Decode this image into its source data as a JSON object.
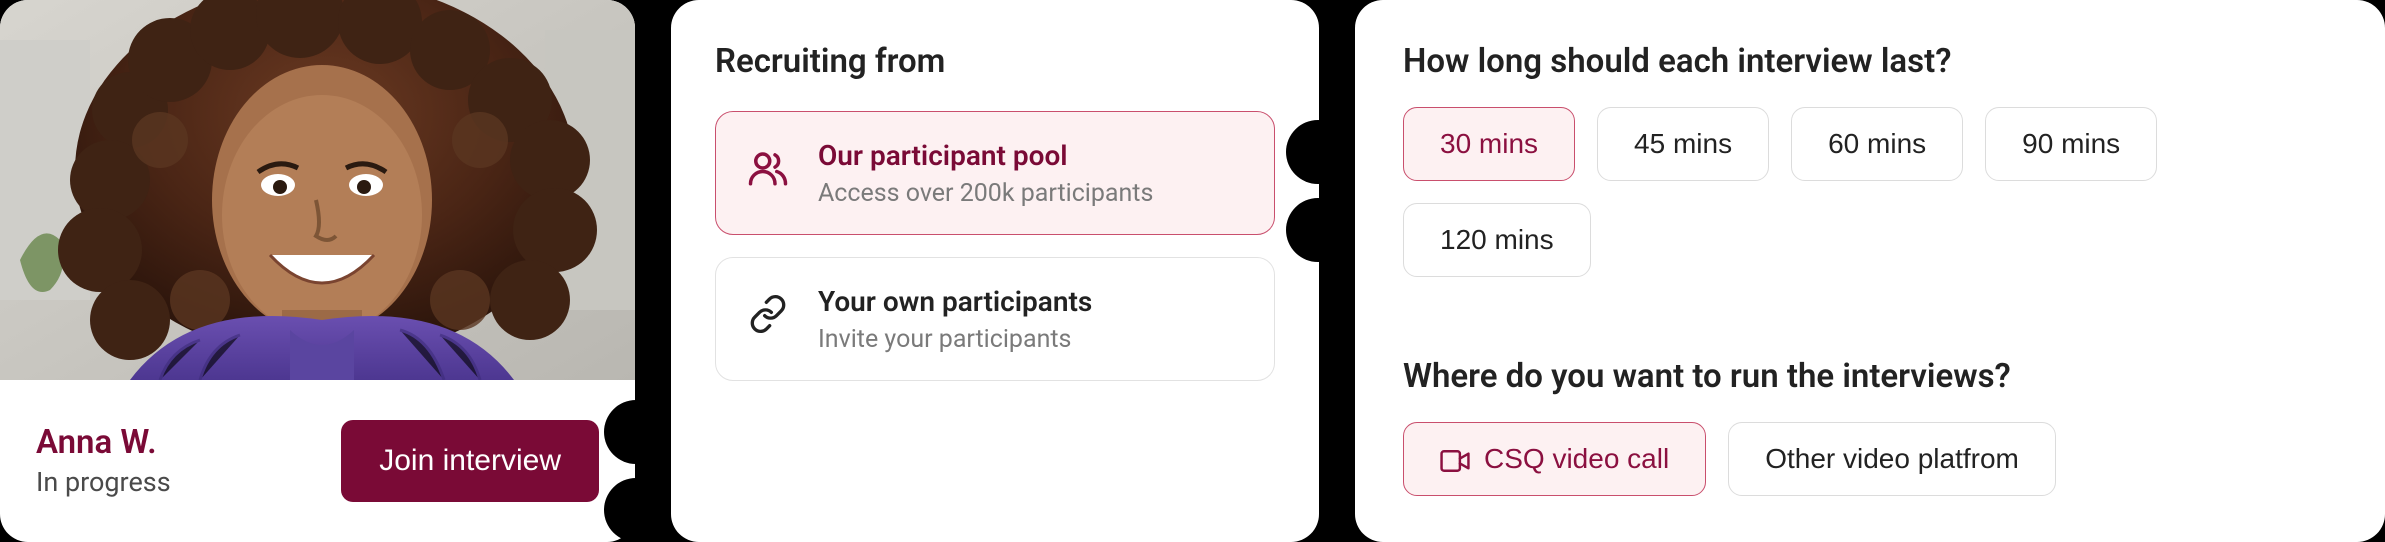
{
  "participant": {
    "name": "Anna W.",
    "status": "In progress",
    "join_label": "Join interview"
  },
  "recruiting": {
    "title": "Recruiting from",
    "options": [
      {
        "title": "Our participant pool",
        "sub": "Access over 200k participants",
        "selected": true,
        "icon": "people-icon"
      },
      {
        "title": "Your own participants",
        "sub": "Invite your participants",
        "selected": false,
        "icon": "link-icon"
      }
    ]
  },
  "settings": {
    "duration_title": "How long should each interview last?",
    "durations": [
      {
        "label": "30 mins",
        "selected": true
      },
      {
        "label": "45 mins",
        "selected": false
      },
      {
        "label": "60 mins",
        "selected": false
      },
      {
        "label": "90 mins",
        "selected": false
      },
      {
        "label": "120 mins",
        "selected": false
      }
    ],
    "platform_title": "Where do you want to run the interviews?",
    "platforms": [
      {
        "label": "CSQ video call",
        "selected": true,
        "icon": "video-icon"
      },
      {
        "label": "Other video platfrom",
        "selected": false
      }
    ]
  },
  "colors": {
    "accent": "#7a0a36",
    "accent_light": "#fdf1f2",
    "accent_border": "#c94f6d"
  }
}
